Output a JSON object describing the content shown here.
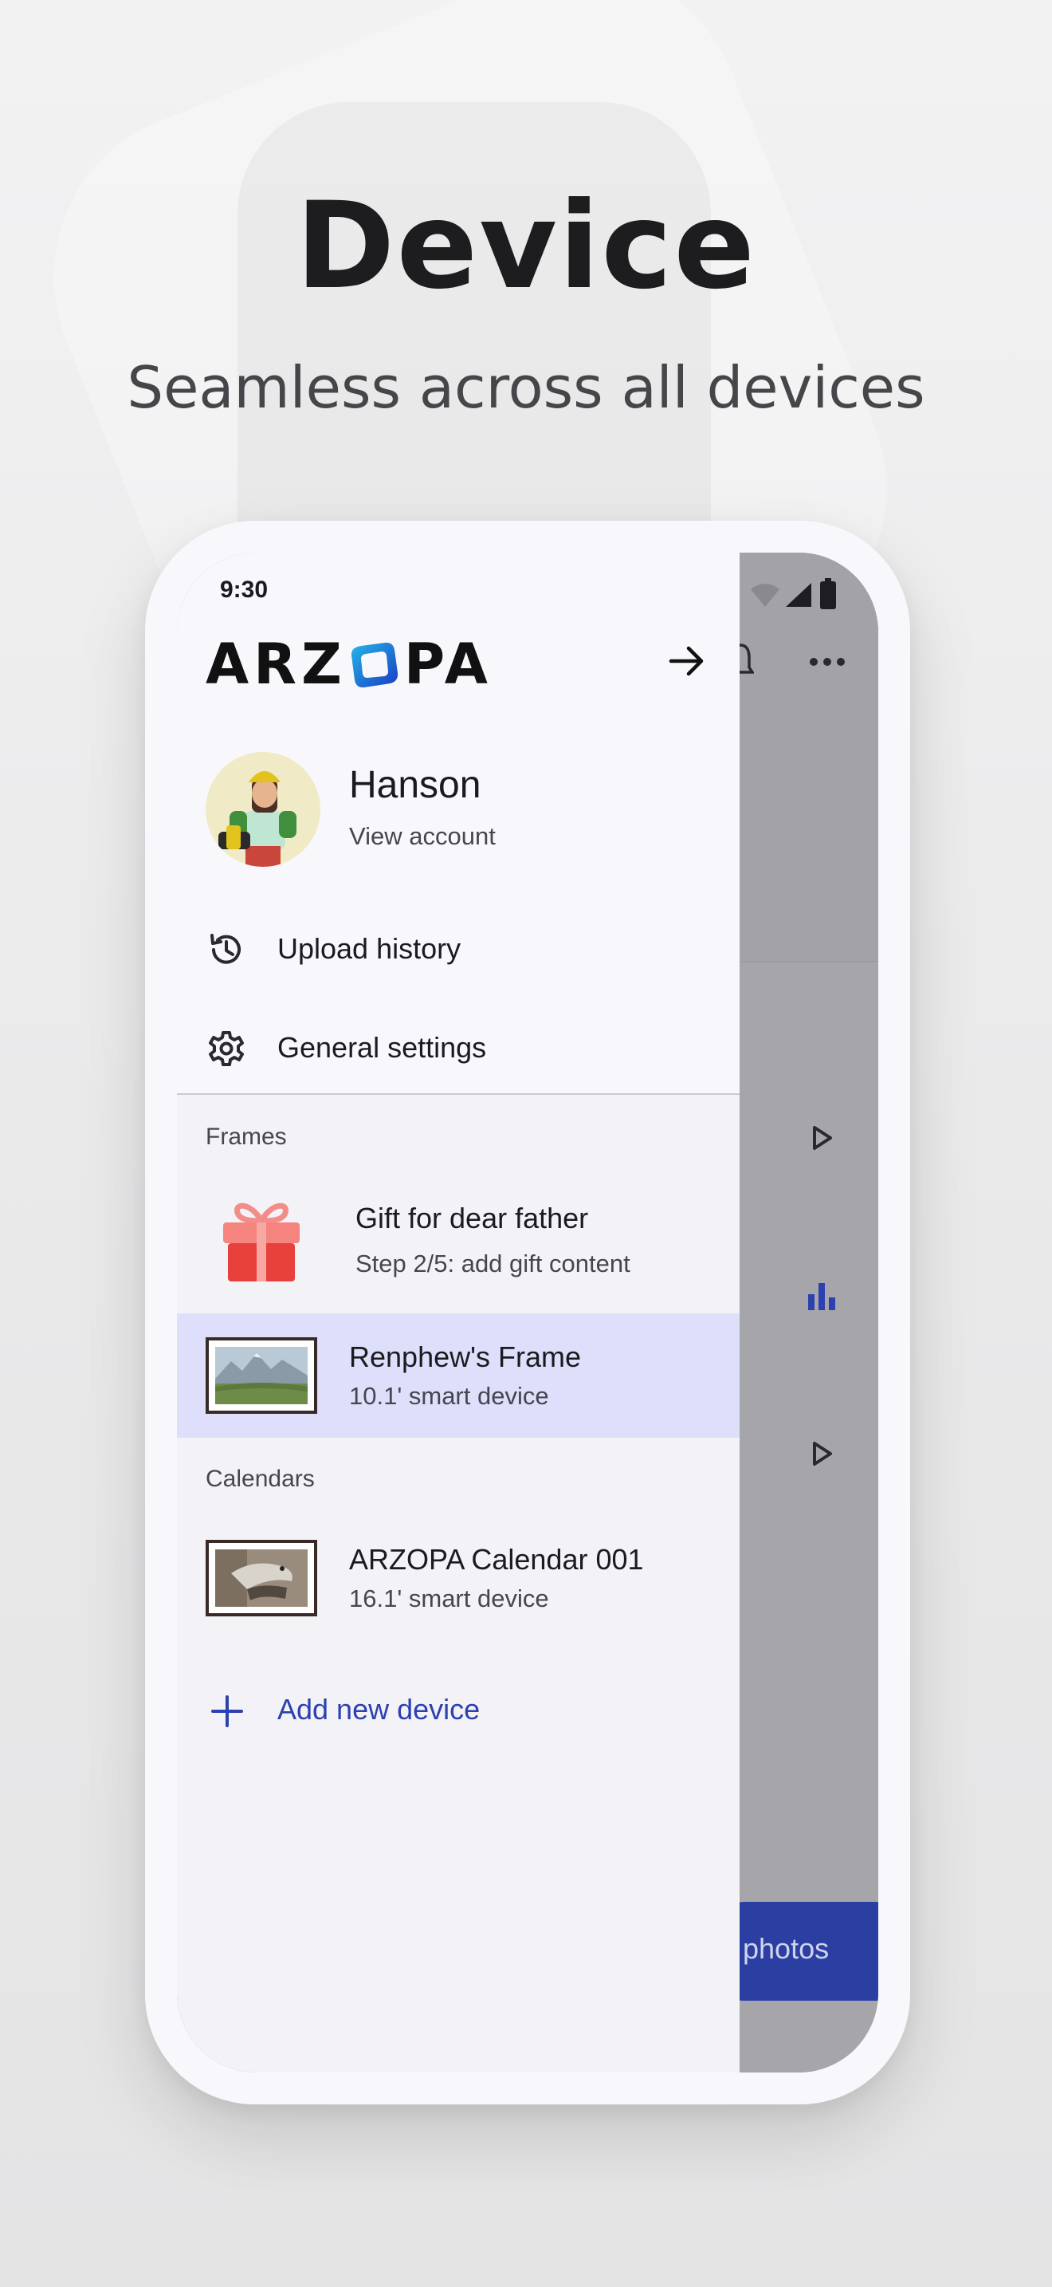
{
  "headline": "Device",
  "subheadline": "Seamless across all devices",
  "status_bar": {
    "time": "9:30"
  },
  "brand": {
    "logo_left": "ARZ",
    "logo_right": "PA",
    "logo_mark": "hexagon-o-logo-mark"
  },
  "profile": {
    "name": "Hanson",
    "view_account": "View account"
  },
  "menu": [
    {
      "label": "Upload history",
      "icon": "history-icon"
    },
    {
      "label": "General settings",
      "icon": "gear-icon"
    }
  ],
  "frames": {
    "section_title": "Frames",
    "gift": {
      "title": "Gift for dear father",
      "subtitle": "Step 2/5: add gift content",
      "icon": "gift-icon"
    },
    "device": {
      "name": "Renphew's Frame",
      "subtitle": "10.1' smart device",
      "selected": true
    }
  },
  "calendars": {
    "section_title": "Calendars",
    "device": {
      "name": "ARZOPA Calendar 001",
      "subtitle": "16.1' smart device"
    }
  },
  "add_device": {
    "label": "Add new device",
    "icon": "plus-icon"
  },
  "background_app": {
    "fab_label": "photos"
  },
  "colors": {
    "accent": "#2c40b0",
    "selected_row": "#dedffb",
    "scrim": "#a6a6aa",
    "fab": "#2b3fa3"
  }
}
